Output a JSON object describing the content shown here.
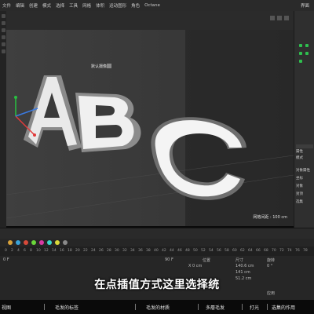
{
  "menubar": {
    "items": [
      "文件",
      "编辑",
      "创建",
      "模式",
      "选择",
      "工具",
      "网格",
      "体积",
      "运动图形",
      "角色",
      "动画",
      "模拟",
      "跟踪器",
      "渲染",
      "扩展",
      "窗口",
      "帮助",
      "Octane"
    ],
    "right": "界面"
  },
  "viewport": {
    "camera_label": "默认摄像机",
    "grid_info": "网格间距 : 100 cm",
    "letters": [
      "A",
      "B",
      "C"
    ]
  },
  "right_panel": {
    "labels": [
      "属性",
      "模式",
      "编辑",
      "对象属性",
      "坐标",
      "对象",
      "封顶",
      "选集"
    ]
  },
  "timeline": {
    "tick_labels": [
      "0",
      "2",
      "4",
      "6",
      "8",
      "10",
      "12",
      "14",
      "16",
      "18",
      "20",
      "22",
      "24",
      "26",
      "28",
      "30",
      "32",
      "34",
      "36",
      "38",
      "40",
      "42",
      "44",
      "46",
      "48",
      "50",
      "52",
      "54",
      "56",
      "58",
      "60",
      "62",
      "64",
      "66",
      "68",
      "70",
      "72",
      "74",
      "76",
      "78",
      "80",
      "82",
      "84",
      "86",
      "88",
      "90"
    ],
    "frame_field": "90 F",
    "current_frame": "0 F"
  },
  "attributes": {
    "labels": [
      "位置",
      "尺寸",
      "旋转"
    ],
    "x": "X 0 cm",
    "pos_x": "140.6 cm",
    "pos_y": "141 cm",
    "pos_z": "51.2 cm",
    "rot": "0 °",
    "apply": "应用"
  },
  "subtitle": "在点插值方式这里选择统",
  "bottom_nav": [
    "视图",
    "毛发的标签",
    "毛发的材质",
    "多層毛发",
    "打光",
    "选集的作用"
  ],
  "colors": {
    "accent_green": "#2fbf4e",
    "viewport_bg": "#3a3a3a",
    "subtitle": "#ffffff"
  }
}
